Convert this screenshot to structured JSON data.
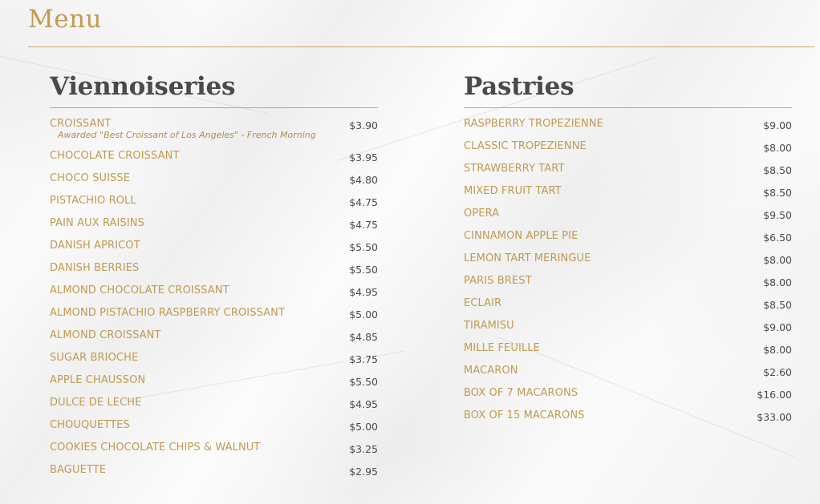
{
  "page": {
    "title": "Menu"
  },
  "colors": {
    "accent_gold": "#c09a52",
    "heading_gray": "#4a4a4a",
    "price_gray": "#4a4a4a",
    "background": "#f4f4f4"
  },
  "viennoiseries": {
    "heading": "Viennoiseries",
    "items": [
      {
        "name": "CROISSANT",
        "note": "Awarded \"Best Croissant of Los Angeles\" - French Morning",
        "price": "$3.90"
      },
      {
        "name": "CHOCOLATE CROISSANT",
        "price": "$3.95"
      },
      {
        "name": "CHOCO SUISSE",
        "price": "$4.80"
      },
      {
        "name": "PISTACHIO ROLL",
        "price": "$4.75"
      },
      {
        "name": "PAIN AUX RAISINS",
        "price": "$4.75"
      },
      {
        "name": "DANISH APRICOT",
        "price": "$5.50"
      },
      {
        "name": "DANISH BERRIES",
        "price": "$5.50"
      },
      {
        "name": "ALMOND CHOCOLATE CROISSANT",
        "price": "$4.95"
      },
      {
        "name": "ALMOND PISTACHIO RASPBERRY CROISSANT",
        "price": "$5.00"
      },
      {
        "name": "ALMOND CROISSANT",
        "price": "$4.85"
      },
      {
        "name": "SUGAR BRIOCHE",
        "price": "$3.75"
      },
      {
        "name": "APPLE CHAUSSON",
        "price": "$5.50"
      },
      {
        "name": "DULCE DE LECHE",
        "price": "$4.95"
      },
      {
        "name": "CHOUQUETTES",
        "price": "$5.00"
      },
      {
        "name": "COOKIES CHOCOLATE CHIPS & WALNUT",
        "price": "$3.25"
      },
      {
        "name": "BAGUETTE",
        "price": "$2.95"
      }
    ]
  },
  "pastries": {
    "heading": "Pastries",
    "items": [
      {
        "name": "RASPBERRY TROPEZIENNE",
        "price": "$9.00"
      },
      {
        "name": "CLASSIC TROPEZIENNE",
        "price": "$8.00"
      },
      {
        "name": "STRAWBERRY TART",
        "price": "$8.50"
      },
      {
        "name": "MIXED FRUIT TART",
        "price": "$8.50"
      },
      {
        "name": "OPERA",
        "price": "$9.50"
      },
      {
        "name": "CINNAMON APPLE PIE",
        "price": "$6.50"
      },
      {
        "name": "LEMON TART MERINGUE",
        "price": "$8.00"
      },
      {
        "name": "PARIS BREST",
        "price": "$8.00"
      },
      {
        "name": "ECLAIR",
        "price": "$8.50"
      },
      {
        "name": "TIRAMISU",
        "price": "$9.00"
      },
      {
        "name": "MILLE FEUILLE",
        "price": "$8.00"
      },
      {
        "name": "MACARON",
        "price": "$2.60"
      },
      {
        "name": "BOX OF 7 MACARONS",
        "price": "$16.00"
      },
      {
        "name": "BOX OF 15 MACARONS",
        "price": "$33.00"
      }
    ]
  }
}
